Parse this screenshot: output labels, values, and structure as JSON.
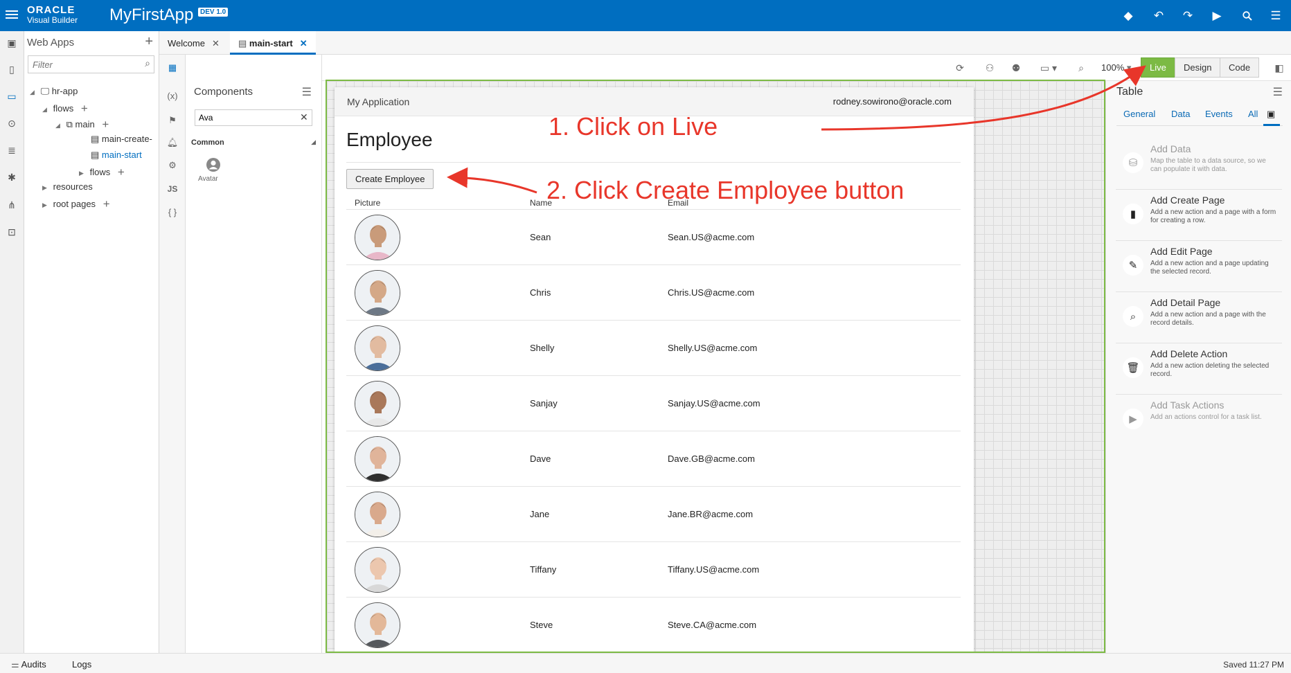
{
  "app": {
    "brand_top": "ORACLE",
    "brand_bottom": "Visual Builder",
    "title": "MyFirstApp",
    "badge": "DEV 1.0"
  },
  "topbar_icons": [
    "diamond-icon",
    "undo-icon",
    "redo-icon",
    "run-icon",
    "search-icon",
    "menu-icon"
  ],
  "navigator": {
    "title": "Web Apps",
    "filter_placeholder": "Filter",
    "tree": {
      "app": "hr-app",
      "flows": "flows",
      "main": "main",
      "main_create": "main-create-",
      "main_start": "main-start",
      "sub_flows": "flows",
      "resources": "resources",
      "root_pages": "root pages"
    }
  },
  "tabs": [
    {
      "label": "Welcome"
    },
    {
      "label": "main-start"
    }
  ],
  "components": {
    "title": "Components",
    "search_value": "Ava",
    "section": "Common",
    "item": "Avatar"
  },
  "toolbar": {
    "zoom": "100%",
    "modes": {
      "live": "Live",
      "design": "Design",
      "code": "Code"
    }
  },
  "page": {
    "app_name": "My Application",
    "user": "rodney.sowirono@oracle.com",
    "heading": "Employee",
    "create_button": "Create Employee",
    "columns": {
      "picture": "Picture",
      "name": "Name",
      "email": "Email"
    },
    "rows": [
      {
        "name": "Sean",
        "email": "Sean.US@acme.com"
      },
      {
        "name": "Chris",
        "email": "Chris.US@acme.com"
      },
      {
        "name": "Shelly",
        "email": "Shelly.US@acme.com"
      },
      {
        "name": "Sanjay",
        "email": "Sanjay.US@acme.com"
      },
      {
        "name": "Dave",
        "email": "Dave.GB@acme.com"
      },
      {
        "name": "Jane",
        "email": "Jane.BR@acme.com"
      },
      {
        "name": "Tiffany",
        "email": "Tiffany.US@acme.com"
      },
      {
        "name": "Steve",
        "email": "Steve.CA@acme.com"
      }
    ]
  },
  "properties": {
    "title": "Table",
    "tabs": {
      "general": "General",
      "data": "Data",
      "events": "Events",
      "all": "All"
    },
    "actions": [
      {
        "title": "Add Data",
        "desc": "Map the table to a data source, so we can populate it with data."
      },
      {
        "title": "Add Create Page",
        "desc": "Add a new action and a page with a form for creating a row."
      },
      {
        "title": "Add Edit Page",
        "desc": "Add a new action and a page updating the selected record."
      },
      {
        "title": "Add Detail Page",
        "desc": "Add a new action and a page with the record details."
      },
      {
        "title": "Add Delete Action",
        "desc": "Add a new action deleting the selected record."
      },
      {
        "title": "Add Task Actions",
        "desc": "Add an actions control for a task list."
      }
    ]
  },
  "status": {
    "audits": "Audits",
    "logs": "Logs",
    "saved": "Saved 11:27 PM"
  },
  "annotations": {
    "step1": "1. Click on Live",
    "step2": "2. Click Create Employee button",
    "color": "#e8362a"
  },
  "colors": {
    "brand": "#006ec0",
    "live": "#7cba44"
  }
}
